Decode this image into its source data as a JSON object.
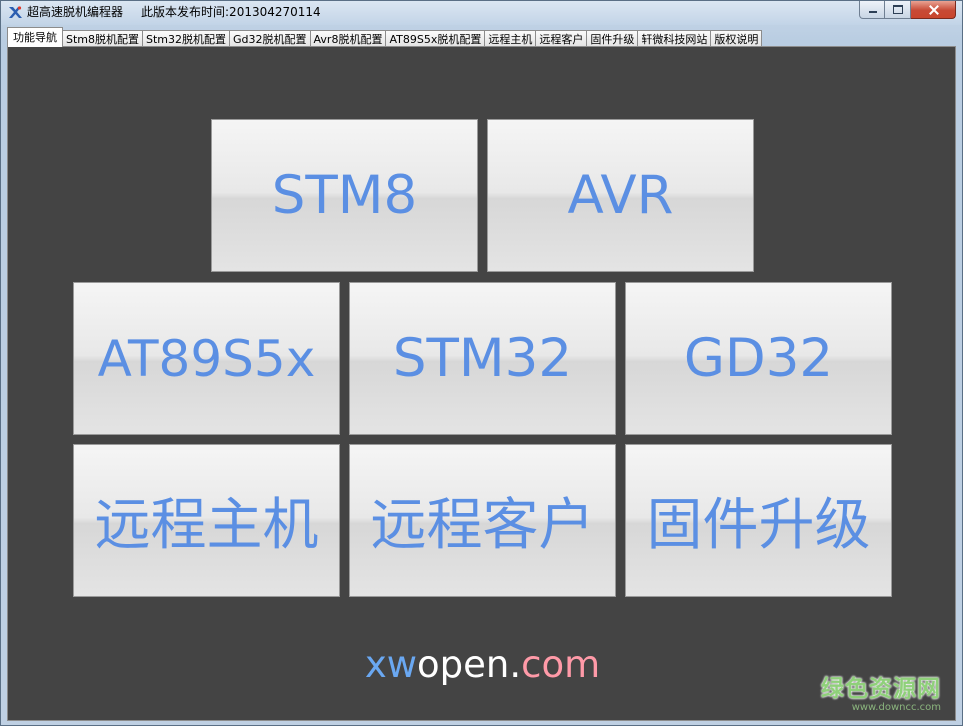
{
  "window": {
    "title": "超高速脱机编程器",
    "release_info": "此版本发布时间:201304270114"
  },
  "tabs": [
    {
      "label": "功能导航",
      "active": true
    },
    {
      "label": "Stm8脱机配置"
    },
    {
      "label": "Stm32脱机配置"
    },
    {
      "label": "Gd32脱机配置"
    },
    {
      "label": "Avr8脱机配置"
    },
    {
      "label": "AT89S5x脱机配置"
    },
    {
      "label": "远程主机"
    },
    {
      "label": "远程客户"
    },
    {
      "label": "固件升级"
    },
    {
      "label": "轩微科技网站"
    },
    {
      "label": "版权说明"
    }
  ],
  "tiles": {
    "stm8": "STM8",
    "avr": "AVR",
    "at89s5x": "AT89S5x",
    "stm32": "STM32",
    "gd32": "GD32",
    "remote_host": "远程主机",
    "remote_client": "远程客户",
    "firmware_upgrade": "固件升级"
  },
  "brand": {
    "part1": "xw",
    "part2": "open.",
    "part3": "com"
  },
  "watermark": {
    "site_name": "绿色资源网",
    "url": "www.downcc.com"
  },
  "colors": {
    "panel_bg": "#444444",
    "tile_text": "#5b8fe3",
    "brand_xw": "#6aa8f2",
    "brand_open": "#ffffff",
    "brand_com": "#ff9aa8"
  }
}
